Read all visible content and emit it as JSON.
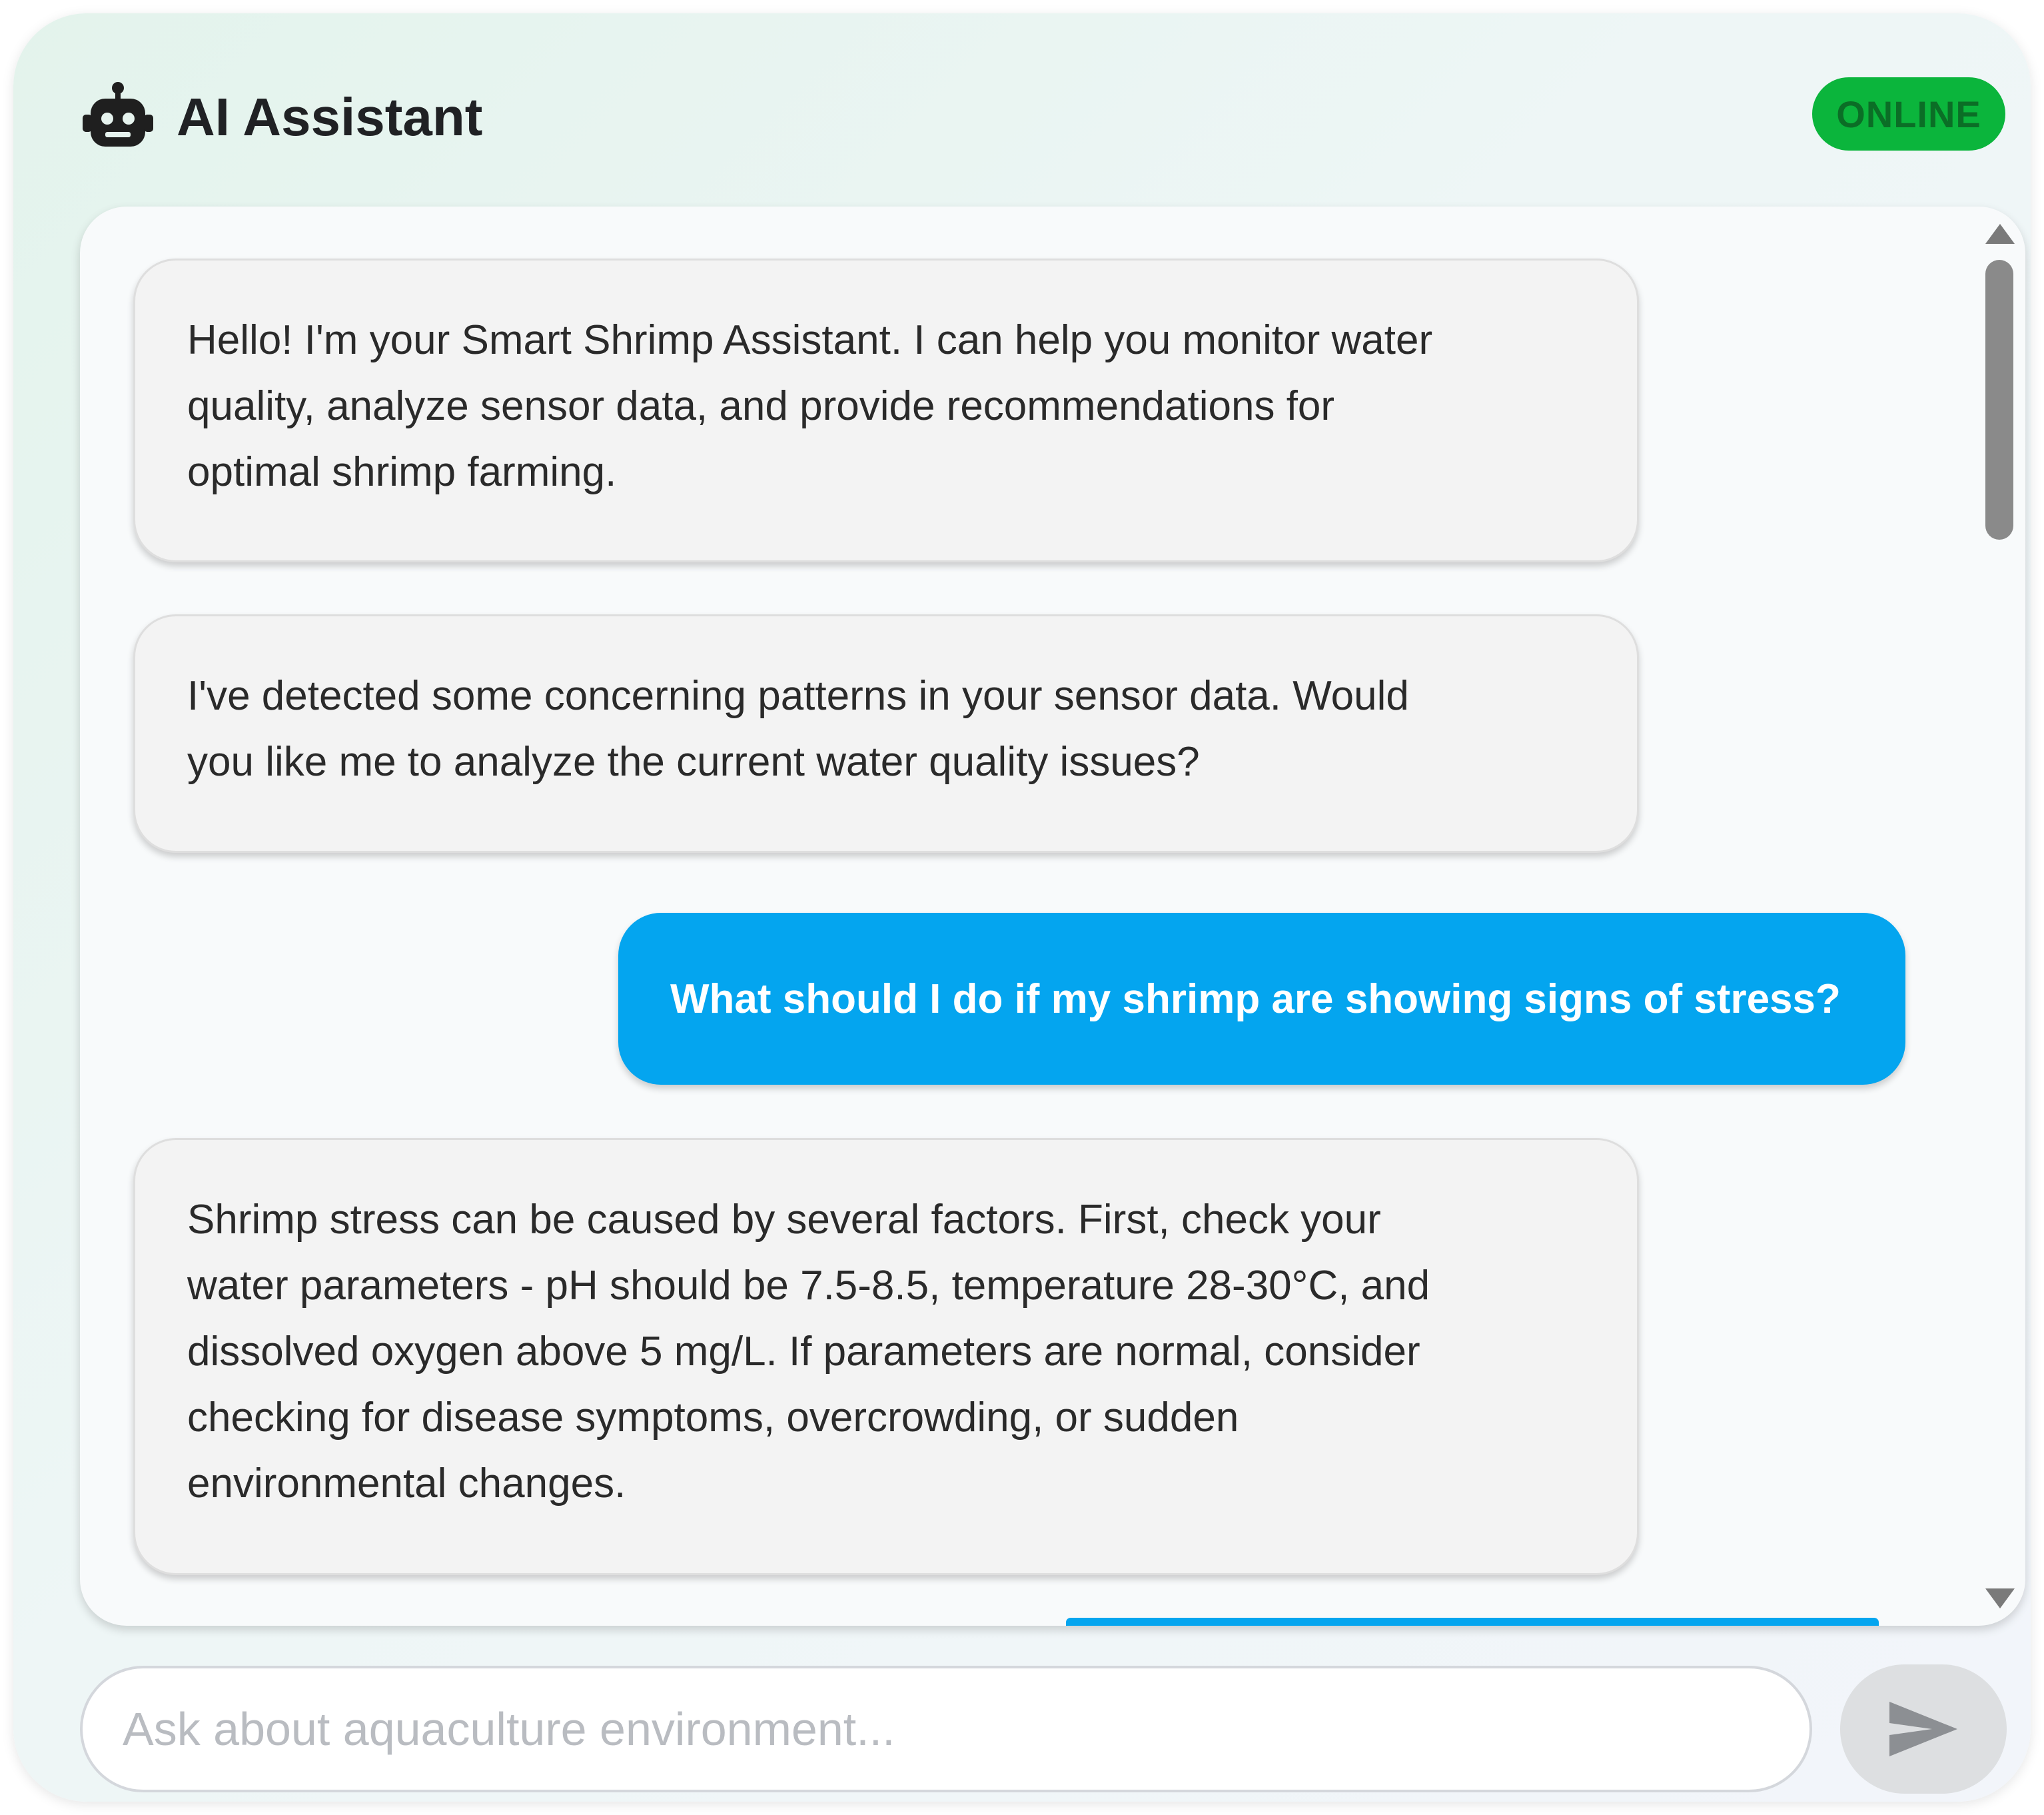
{
  "header": {
    "title": "AI Assistant",
    "icon": "robot-icon",
    "status": "ONLINE",
    "status_color": "#0bb53c"
  },
  "messages": [
    {
      "role": "assistant",
      "text": "Hello! I'm your Smart Shrimp Assistant. I can help you monitor water\nquality, analyze sensor data, and provide recommendations for\noptimal shrimp farming."
    },
    {
      "role": "assistant",
      "text": "I've detected some concerning patterns in your sensor data. Would\nyou like me to analyze the current water quality issues?"
    },
    {
      "role": "user",
      "text": "What should I do if my shrimp are showing signs of stress?"
    },
    {
      "role": "assistant",
      "text": "Shrimp stress can be caused by several factors. First, check your\nwater parameters - pH should be 7.5-8.5, temperature 28-30°C, and\ndissolved oxygen above 5 mg/L. If parameters are normal, consider\nchecking for disease symptoms, overcrowding, or sudden\nenvironmental changes."
    }
  ],
  "input": {
    "placeholder": "Ask about aquaculture environment...",
    "value": ""
  },
  "send_button": {
    "icon": "send-icon"
  },
  "colors": {
    "user_bubble": "#04a5ef",
    "assistant_bubble": "#f3f3f3"
  }
}
